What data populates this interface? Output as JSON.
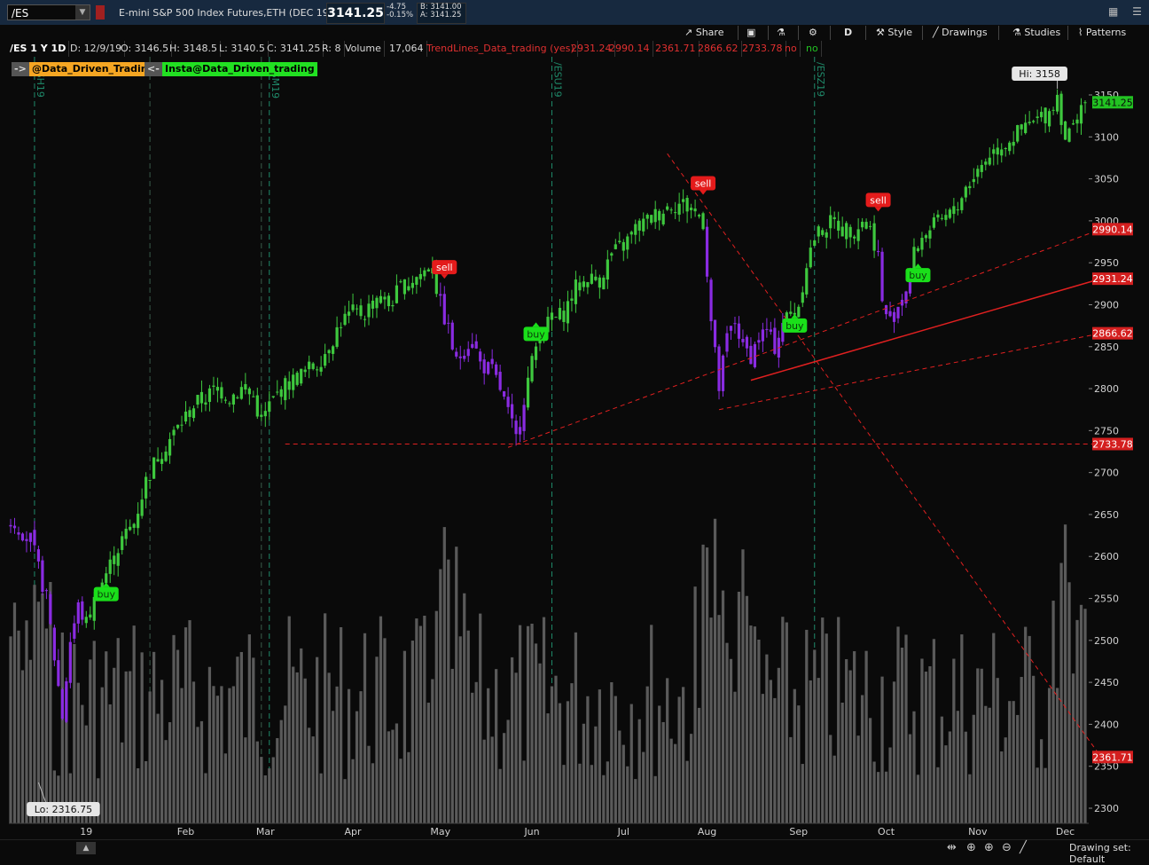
{
  "header": {
    "symbol": "/ES",
    "description": "E-mini S&P 500 Index Futures,ETH (DEC 19)",
    "last": "3141.25",
    "change": "-4.75",
    "change_pct": "-0.15%",
    "bid": "B: 3141.00",
    "ask": "A: 3141.25"
  },
  "toolbar": {
    "share": "Share",
    "period": "D",
    "style": "Style",
    "drawings": "Drawings",
    "studies": "Studies",
    "patterns": "Patterns"
  },
  "infobar": {
    "symbol_tf": "/ES 1 Y 1D",
    "date": "D: 12/9/19",
    "open": "O: 3146.5",
    "high": "H: 3148.5",
    "low": "L: 3140.5",
    "close": "C: 3141.25",
    "range": "R: 8",
    "volume_label": "Volume",
    "volume_value": "17,064",
    "study_name": "TrendLines_Data_trading (yes)",
    "study_values": [
      "2931.24",
      "2990.14",
      "2361.71",
      "2866.62",
      "2733.78"
    ],
    "flag1": "no",
    "flag2": "no"
  },
  "tags": {
    "arrow_left": "->",
    "tag1": "@Data_Driven_Trading",
    "arrow_right": "<-",
    "tag2": "Insta@Data_Driven_trading"
  },
  "chart_data": {
    "type": "candlestick",
    "title": "/ES 1 Y 1D",
    "x_labels": [
      "19",
      "Feb",
      "Mar",
      "Apr",
      "May",
      "Jun",
      "Jul",
      "Aug",
      "Sep",
      "Oct",
      "Nov",
      "Dec"
    ],
    "x_label_days": [
      0,
      25,
      45,
      67,
      89,
      112,
      135,
      156,
      179,
      201,
      224,
      246
    ],
    "ylim": [
      2280,
      3190
    ],
    "yticks": [
      2300,
      2350,
      2400,
      2450,
      2500,
      2550,
      2600,
      2650,
      2700,
      2750,
      2800,
      2850,
      2900,
      2950,
      3000,
      3050,
      3100,
      3150
    ],
    "grid": false,
    "contract_rolls": [
      {
        "label": "/ESH19",
        "day": -13
      },
      {
        "label": "/ESM19",
        "day": 46
      },
      {
        "label": "/ESU19",
        "day": 117
      },
      {
        "label": "/ESZ19",
        "day": 183
      }
    ],
    "month_markers_days": [
      16,
      44
    ],
    "hi_label": "Hi: 3158",
    "lo_label": "Lo: 2316.75",
    "current_price": 3141.25,
    "current_price_label": "3141.25",
    "close_anchors": [
      [
        -18,
        2640
      ],
      [
        -14,
        2620
      ],
      [
        -10,
        2550
      ],
      [
        -8,
        2480
      ],
      [
        -6,
        2410
      ],
      [
        -4,
        2500
      ],
      [
        -2,
        2540
      ],
      [
        0,
        2520
      ],
      [
        3,
        2560
      ],
      [
        6,
        2590
      ],
      [
        9,
        2620
      ],
      [
        12,
        2640
      ],
      [
        15,
        2690
      ],
      [
        18,
        2720
      ],
      [
        21,
        2740
      ],
      [
        24,
        2760
      ],
      [
        27,
        2780
      ],
      [
        30,
        2790
      ],
      [
        33,
        2800
      ],
      [
        36,
        2790
      ],
      [
        39,
        2800
      ],
      [
        42,
        2790
      ],
      [
        44,
        2760
      ],
      [
        46,
        2780
      ],
      [
        49,
        2800
      ],
      [
        52,
        2810
      ],
      [
        55,
        2820
      ],
      [
        58,
        2830
      ],
      [
        61,
        2850
      ],
      [
        64,
        2880
      ],
      [
        67,
        2890
      ],
      [
        70,
        2890
      ],
      [
        73,
        2910
      ],
      [
        76,
        2900
      ],
      [
        79,
        2920
      ],
      [
        82,
        2930
      ],
      [
        85,
        2940
      ],
      [
        87,
        2950
      ],
      [
        88,
        2920
      ],
      [
        89,
        2900
      ],
      [
        91,
        2870
      ],
      [
        93,
        2830
      ],
      [
        95,
        2850
      ],
      [
        97,
        2860
      ],
      [
        99,
        2830
      ],
      [
        102,
        2820
      ],
      [
        104,
        2800
      ],
      [
        106,
        2770
      ],
      [
        108,
        2740
      ],
      [
        110,
        2790
      ],
      [
        112,
        2830
      ],
      [
        114,
        2870
      ],
      [
        117,
        2880
      ],
      [
        120,
        2890
      ],
      [
        123,
        2920
      ],
      [
        126,
        2930
      ],
      [
        129,
        2930
      ],
      [
        132,
        2960
      ],
      [
        135,
        2970
      ],
      [
        138,
        2990
      ],
      [
        141,
        3000
      ],
      [
        144,
        3010
      ],
      [
        147,
        3020
      ],
      [
        150,
        3020
      ],
      [
        153,
        3010
      ],
      [
        155,
        3000
      ],
      [
        156,
        2940
      ],
      [
        157,
        2880
      ],
      [
        158,
        2840
      ],
      [
        159,
        2800
      ],
      [
        161,
        2860
      ],
      [
        163,
        2880
      ],
      [
        165,
        2850
      ],
      [
        167,
        2840
      ],
      [
        169,
        2860
      ],
      [
        171,
        2870
      ],
      [
        173,
        2850
      ],
      [
        175,
        2880
      ],
      [
        177,
        2890
      ],
      [
        179,
        2900
      ],
      [
        181,
        2950
      ],
      [
        183,
        2980
      ],
      [
        185,
        2990
      ],
      [
        188,
        3000
      ],
      [
        190,
        2990
      ],
      [
        193,
        2990
      ],
      [
        195,
        3000
      ],
      [
        197,
        2990
      ],
      [
        199,
        2960
      ],
      [
        200,
        2900
      ],
      [
        202,
        2880
      ],
      [
        204,
        2900
      ],
      [
        206,
        2920
      ],
      [
        208,
        2960
      ],
      [
        210,
        2980
      ],
      [
        212,
        2990
      ],
      [
        215,
        3000
      ],
      [
        218,
        3010
      ],
      [
        221,
        3040
      ],
      [
        224,
        3060
      ],
      [
        227,
        3080
      ],
      [
        230,
        3090
      ],
      [
        233,
        3100
      ],
      [
        236,
        3110
      ],
      [
        239,
        3120
      ],
      [
        242,
        3130
      ],
      [
        244,
        3150
      ],
      [
        246,
        3100
      ],
      [
        248,
        3110
      ],
      [
        250,
        3141
      ]
    ],
    "signals": [
      {
        "type": "buy",
        "day": 5,
        "price": 2570
      },
      {
        "type": "sell",
        "day": 90,
        "price": 2930
      },
      {
        "type": "buy",
        "day": 113,
        "price": 2880
      },
      {
        "type": "sell",
        "day": 155,
        "price": 3030
      },
      {
        "type": "buy",
        "day": 178,
        "price": 2890
      },
      {
        "type": "sell",
        "day": 199,
        "price": 3010
      },
      {
        "type": "buy",
        "day": 209,
        "price": 2950
      }
    ],
    "trendlines": [
      {
        "id": "tl-2733",
        "style": "dashed",
        "from": [
          50,
          2734
        ],
        "to": [
          255,
          2734
        ],
        "label": "2733.78"
      },
      {
        "id": "tl-2990",
        "style": "dashed",
        "from": [
          106,
          2730
        ],
        "to": [
          255,
          2990
        ],
        "label": "2990.14"
      },
      {
        "id": "tl-2931",
        "style": "solid",
        "from": [
          167,
          2810
        ],
        "to": [
          255,
          2931
        ],
        "label": "2931.24"
      },
      {
        "id": "tl-2866",
        "style": "dashed",
        "from": [
          159,
          2775
        ],
        "to": [
          255,
          2866
        ],
        "label": "2866.62"
      },
      {
        "id": "tl-2361",
        "style": "dashed",
        "from": [
          146,
          3080
        ],
        "to": [
          255,
          2361
        ],
        "label": "2361.71"
      }
    ],
    "volume": {
      "min_label": null,
      "seed": 7
    }
  },
  "bottom": {
    "drawing_set": "Drawing set: Default"
  }
}
